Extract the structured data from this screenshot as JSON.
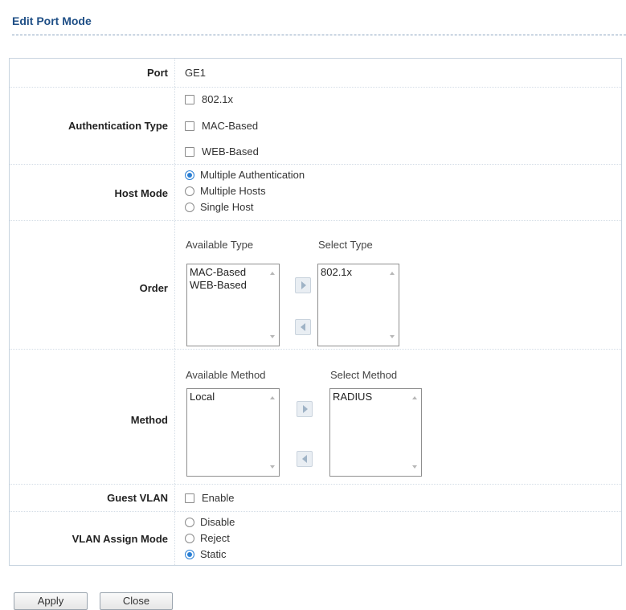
{
  "page_title": "Edit Port Mode",
  "port": {
    "label": "Port",
    "value": "GE1"
  },
  "auth_type": {
    "label": "Authentication Type",
    "options": [
      {
        "label": "802.1x",
        "checked": false
      },
      {
        "label": "MAC-Based",
        "checked": false
      },
      {
        "label": "WEB-Based",
        "checked": false
      }
    ]
  },
  "host_mode": {
    "label": "Host Mode",
    "options": [
      {
        "label": "Multiple Authentication",
        "selected": true
      },
      {
        "label": "Multiple Hosts",
        "selected": false
      },
      {
        "label": "Single Host",
        "selected": false
      }
    ]
  },
  "order": {
    "label": "Order",
    "available_header": "Available Type",
    "select_header": "Select Type",
    "available_items": [
      "MAC-Based",
      "WEB-Based"
    ],
    "selected_items": [
      "802.1x"
    ]
  },
  "method": {
    "label": "Method",
    "available_header": "Available Method",
    "select_header": "Select Method",
    "available_items": [
      "Local"
    ],
    "selected_items": [
      "RADIUS"
    ]
  },
  "guest_vlan": {
    "label": "Guest VLAN",
    "option": "Enable",
    "checked": false
  },
  "vlan_assign": {
    "label": "VLAN Assign Mode",
    "options": [
      {
        "label": "Disable",
        "selected": false
      },
      {
        "label": "Reject",
        "selected": false
      },
      {
        "label": "Static",
        "selected": true
      }
    ]
  },
  "buttons": {
    "apply": "Apply",
    "close": "Close"
  },
  "colors": {
    "title": "#1f4f86",
    "radio_selected": "#2a7fd4",
    "border": "#c8d4e0"
  }
}
